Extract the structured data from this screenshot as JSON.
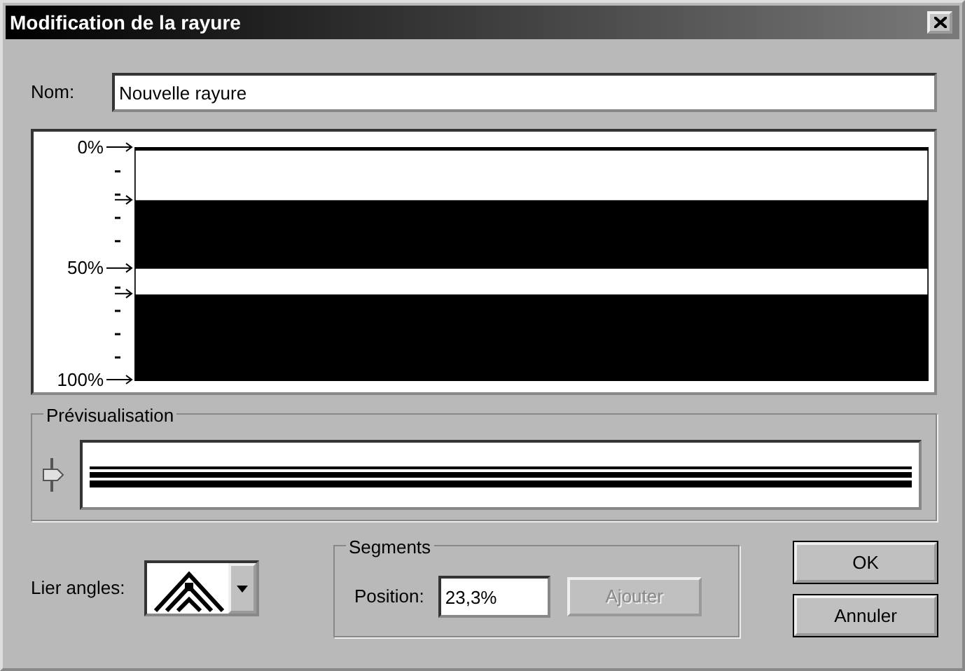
{
  "window": {
    "title": "Modification de la rayure"
  },
  "name_field": {
    "label": "Nom:",
    "value": "Nouvelle rayure"
  },
  "stripe_editor": {
    "scale_labels": [
      "0%",
      "50%",
      "100%"
    ]
  },
  "preview": {
    "title": "Prévisualisation"
  },
  "link_angles": {
    "label": "Lier angles:"
  },
  "segments": {
    "title": "Segments",
    "position_label": "Position:",
    "position_value": "23,3%",
    "add_button": {
      "label": "Ajouter",
      "disabled": true
    }
  },
  "buttons": [
    {
      "label": "OK"
    },
    {
      "label": "Annuler"
    }
  ]
}
